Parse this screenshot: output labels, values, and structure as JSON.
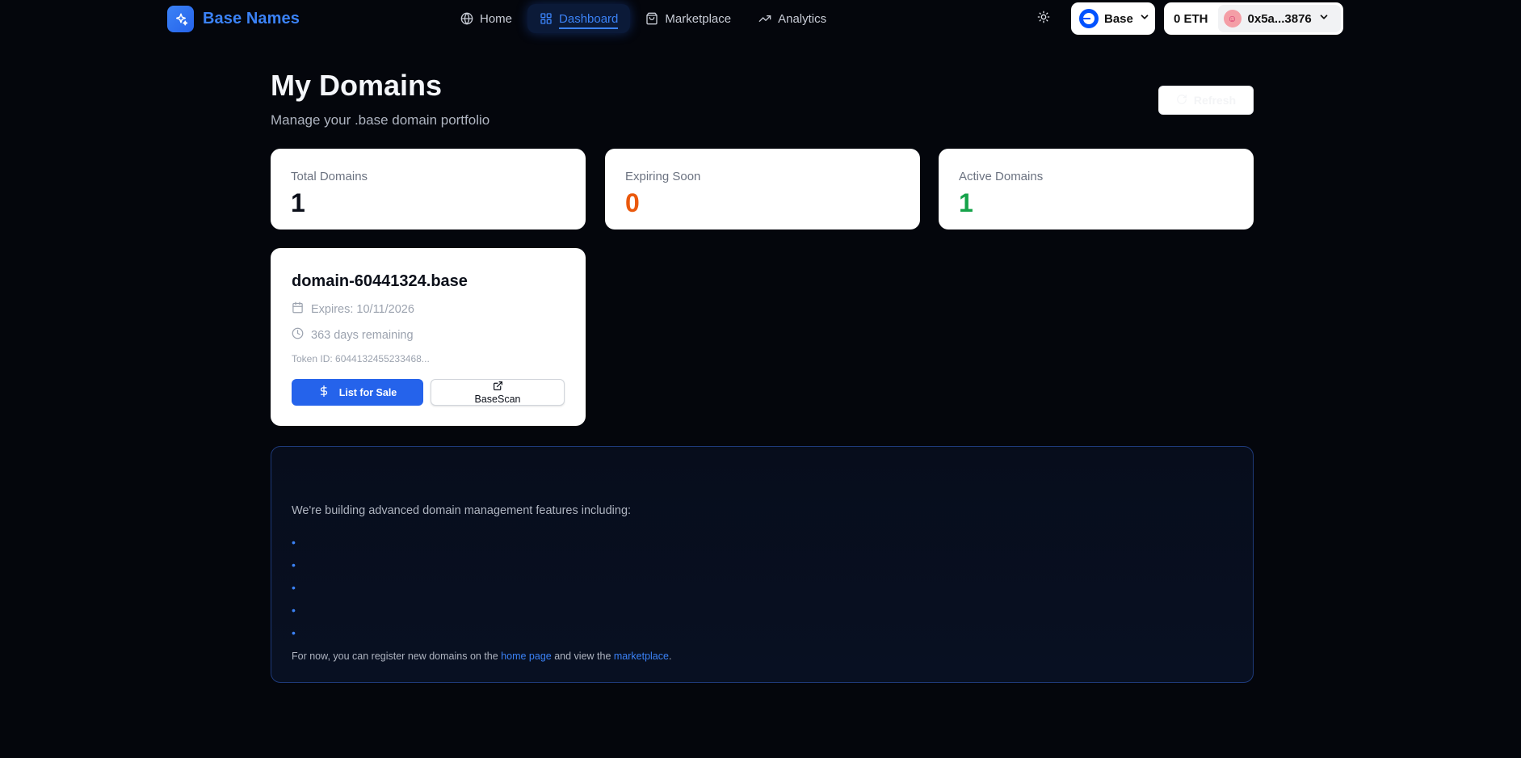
{
  "header": {
    "brand": "Base Names",
    "nav": [
      {
        "label": "Home",
        "icon": "globe-icon",
        "active": false
      },
      {
        "label": "Dashboard",
        "icon": "dashboard-grid-icon",
        "active": true
      },
      {
        "label": "Marketplace",
        "icon": "shopping-bag-icon",
        "active": false
      },
      {
        "label": "Analytics",
        "icon": "trending-up-icon",
        "active": false
      }
    ],
    "theme_icon": "sun-icon",
    "chain": {
      "label": "Base",
      "icon": "base-chain-icon"
    },
    "wallet": {
      "balance": "0 ETH",
      "address": "0x5a...3876"
    }
  },
  "page": {
    "title": "My Domains",
    "subtitle": "Manage your .base domain portfolio",
    "refresh_label": "Refresh"
  },
  "stats": [
    {
      "label": "Total Domains",
      "value": "1",
      "color": "#0b0f19"
    },
    {
      "label": "Expiring Soon",
      "value": "0",
      "color": "#ea580c"
    },
    {
      "label": "Active Domains",
      "value": "1",
      "color": "#16a34a"
    }
  ],
  "domain": {
    "name": "domain-60441324.base",
    "expires": "Expires: 10/11/2026",
    "remaining": "363 days remaining",
    "token_id": "Token ID: 6044132455233468...",
    "list_label": "List for Sale",
    "scan_label": "BaseScan"
  },
  "info": {
    "intro": "We're building advanced domain management features including:",
    "bullets": [
      "",
      "",
      "",
      "",
      ""
    ],
    "footer_prefix": "For now, you can register new domains on the ",
    "footer_link1": "home page",
    "footer_middle": " and view the ",
    "footer_link2": "marketplace",
    "footer_suffix": "."
  },
  "colors": {
    "accent": "#3b82f6",
    "background": "#04060c",
    "expiring": "#ea580c",
    "active": "#16a34a"
  }
}
